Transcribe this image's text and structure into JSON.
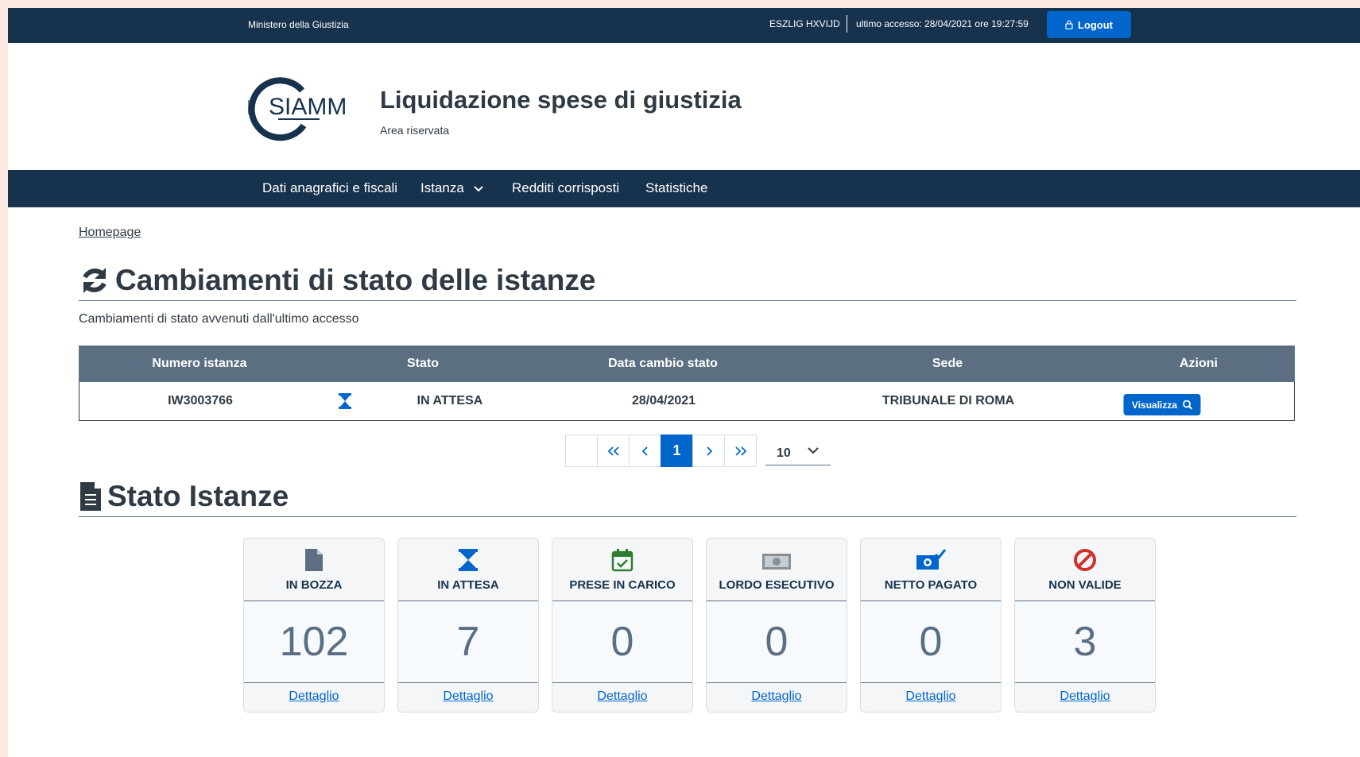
{
  "topbar": {
    "ministry": "Ministero della Giustizia",
    "user": "ESZLIG HXVIJD",
    "last_access": "ultimo accesso: 28/04/2021 ore 19:27:59",
    "logout_label": "Logout"
  },
  "header": {
    "logo_text": "SIAMM",
    "title": "Liquidazione spese di giustizia",
    "subtitle": "Area riservata"
  },
  "nav": {
    "items": [
      {
        "label": "Dati anagrafici e fiscali"
      },
      {
        "label": "Istanza"
      },
      {
        "label": "Redditi corrisposti"
      },
      {
        "label": "Statistiche"
      }
    ]
  },
  "breadcrumb": "Homepage",
  "changes": {
    "title": "Cambiamenti di stato delle istanze",
    "subtitle": "Cambiamenti di stato avvenuti dall'ultimo accesso",
    "columns": [
      "Numero istanza",
      "Stato",
      "Data cambio stato",
      "Sede",
      "Azioni"
    ],
    "rows": [
      {
        "numero": "IW3003766",
        "status_icon": "hourglass-icon",
        "stato": "IN ATTESA",
        "data": "28/04/2021",
        "sede": "TRIBUNALE DI ROMA",
        "action_label": "Visualizza"
      }
    ]
  },
  "pagination": {
    "current_page": "1",
    "page_size": "10"
  },
  "status": {
    "title": "Stato Istanze",
    "cards": [
      {
        "label": "IN BOZZA",
        "value": "102",
        "link": "Dettaglio",
        "icon": "document-icon"
      },
      {
        "label": "IN ATTESA",
        "value": "7",
        "link": "Dettaglio",
        "icon": "hourglass-icon"
      },
      {
        "label": "PRESE IN CARICO",
        "value": "0",
        "link": "Dettaglio",
        "icon": "calendar-check-icon"
      },
      {
        "label": "LORDO ESECUTIVO",
        "value": "0",
        "link": "Dettaglio",
        "icon": "money-icon"
      },
      {
        "label": "NETTO PAGATO",
        "value": "0",
        "link": "Dettaglio",
        "icon": "money-check-icon"
      },
      {
        "label": "NON VALIDE",
        "value": "3",
        "link": "Dettaglio",
        "icon": "ban-icon"
      }
    ]
  },
  "colors": {
    "dark_blue": "#17324d",
    "primary": "#0066cc",
    "table_header": "#5c6f82",
    "success": "#2e7d32",
    "danger": "#d32f2f"
  }
}
